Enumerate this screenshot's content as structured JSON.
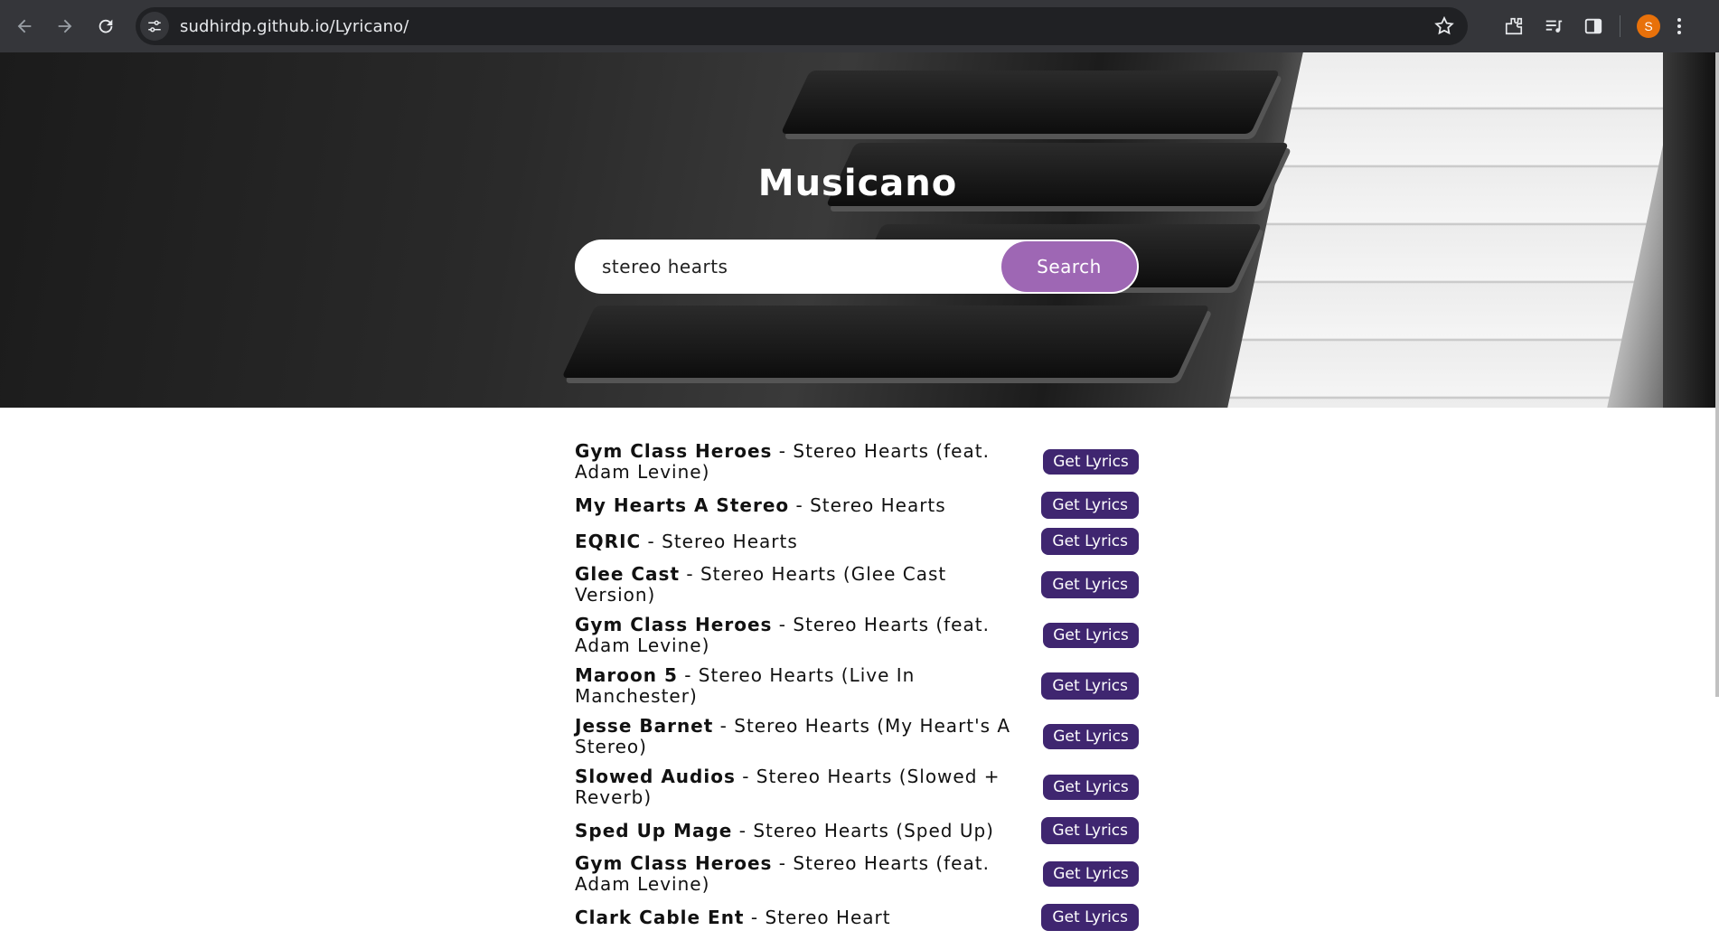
{
  "browser": {
    "url": "sudhirdp.github.io/Lyricano/",
    "profile_initial": "S",
    "colors": {
      "chrome_bg": "#35363a",
      "omnibox_bg": "#202124",
      "avatar": "#e8710a"
    }
  },
  "page": {
    "title": "Musicano",
    "search": {
      "value": "stereo hearts",
      "button_label": "Search"
    },
    "colors": {
      "search_button": "#9e67b4",
      "lyrics_button": "#3f2670"
    }
  },
  "results": [
    {
      "artist": "Gym Class Heroes",
      "song": "Stereo Hearts (feat. Adam Levine)",
      "button": "Get Lyrics",
      "wrap": true
    },
    {
      "artist": "My Hearts A Stereo",
      "song": "Stereo Hearts",
      "button": "Get Lyrics",
      "wrap": false
    },
    {
      "artist": "EQRIC",
      "song": "Stereo Hearts",
      "button": "Get Lyrics",
      "wrap": false
    },
    {
      "artist": "Glee Cast",
      "song": "Stereo Hearts (Glee Cast Version)",
      "button": "Get Lyrics",
      "wrap": false
    },
    {
      "artist": "Gym Class Heroes",
      "song": "Stereo Hearts (feat. Adam Levine)",
      "button": "Get Lyrics",
      "wrap": true
    },
    {
      "artist": "Maroon 5",
      "song": "Stereo Hearts (Live In Manchester)",
      "button": "Get Lyrics",
      "wrap": false
    },
    {
      "artist": "Jesse Barnet",
      "song": "Stereo Hearts (My Heart's A Stereo)",
      "button": "Get Lyrics",
      "wrap": true
    },
    {
      "artist": "Slowed Audios",
      "song": "Stereo Hearts (Slowed + Reverb)",
      "button": "Get Lyrics",
      "wrap": true
    },
    {
      "artist": "Sped Up Mage",
      "song": "Stereo Hearts (Sped Up)",
      "button": "Get Lyrics",
      "wrap": false
    },
    {
      "artist": "Gym Class Heroes",
      "song": "Stereo Hearts (feat. Adam Levine)",
      "button": "Get Lyrics",
      "wrap": true
    },
    {
      "artist": "Clark Cable Ent",
      "song": "Stereo Heart",
      "button": "Get Lyrics",
      "wrap": false
    }
  ]
}
